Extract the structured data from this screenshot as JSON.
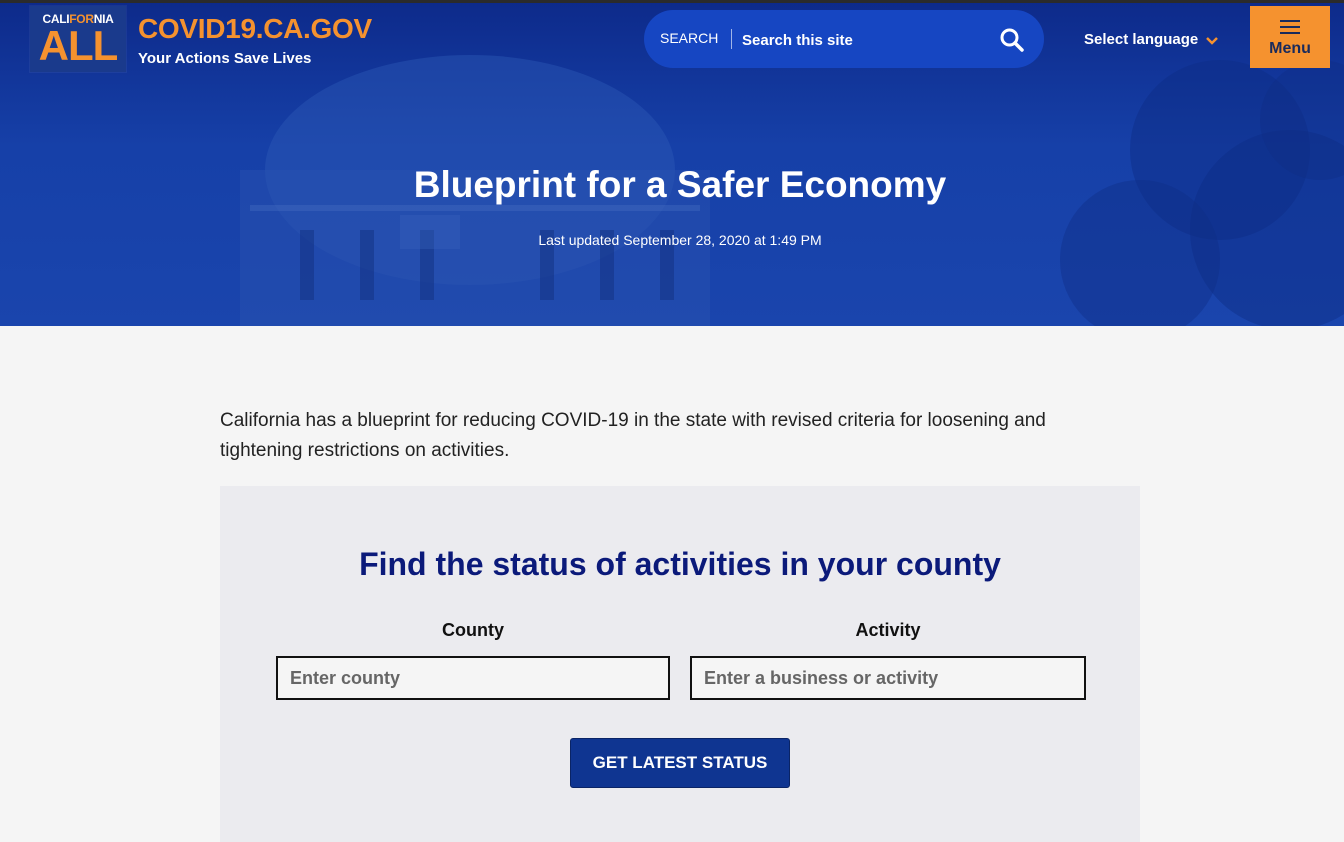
{
  "header": {
    "logo": {
      "top_pre": "CALI",
      "top_mid": "FOR",
      "top_post": "NIA",
      "main": "ALL"
    },
    "site_name": "COVID19.CA.GOV",
    "tagline": "Your Actions Save Lives",
    "search": {
      "label": "SEARCH",
      "placeholder": "Search this site",
      "icon": "search-icon"
    },
    "language": {
      "label": "Select language",
      "icon": "chevron-down-icon"
    },
    "menu": {
      "label": "Menu",
      "icon": "hamburger-icon"
    }
  },
  "hero": {
    "title": "Blueprint for a Safer Economy",
    "updated": "Last updated September 28, 2020 at 1:49 PM"
  },
  "main": {
    "intro": "California has a blueprint for reducing COVID-19 in the state with revised criteria for loosening and tightening restrictions on activities.",
    "finder": {
      "title": "Find the status of activities in your county",
      "county": {
        "label": "County",
        "placeholder": "Enter county"
      },
      "activity": {
        "label": "Activity",
        "placeholder": "Enter a business or activity"
      },
      "button": "GET LATEST STATUS"
    }
  },
  "colors": {
    "brand_blue": "#1640a8",
    "accent_orange": "#f5922f",
    "title_navy": "#0b1a7a",
    "button_blue": "#0f3591"
  }
}
